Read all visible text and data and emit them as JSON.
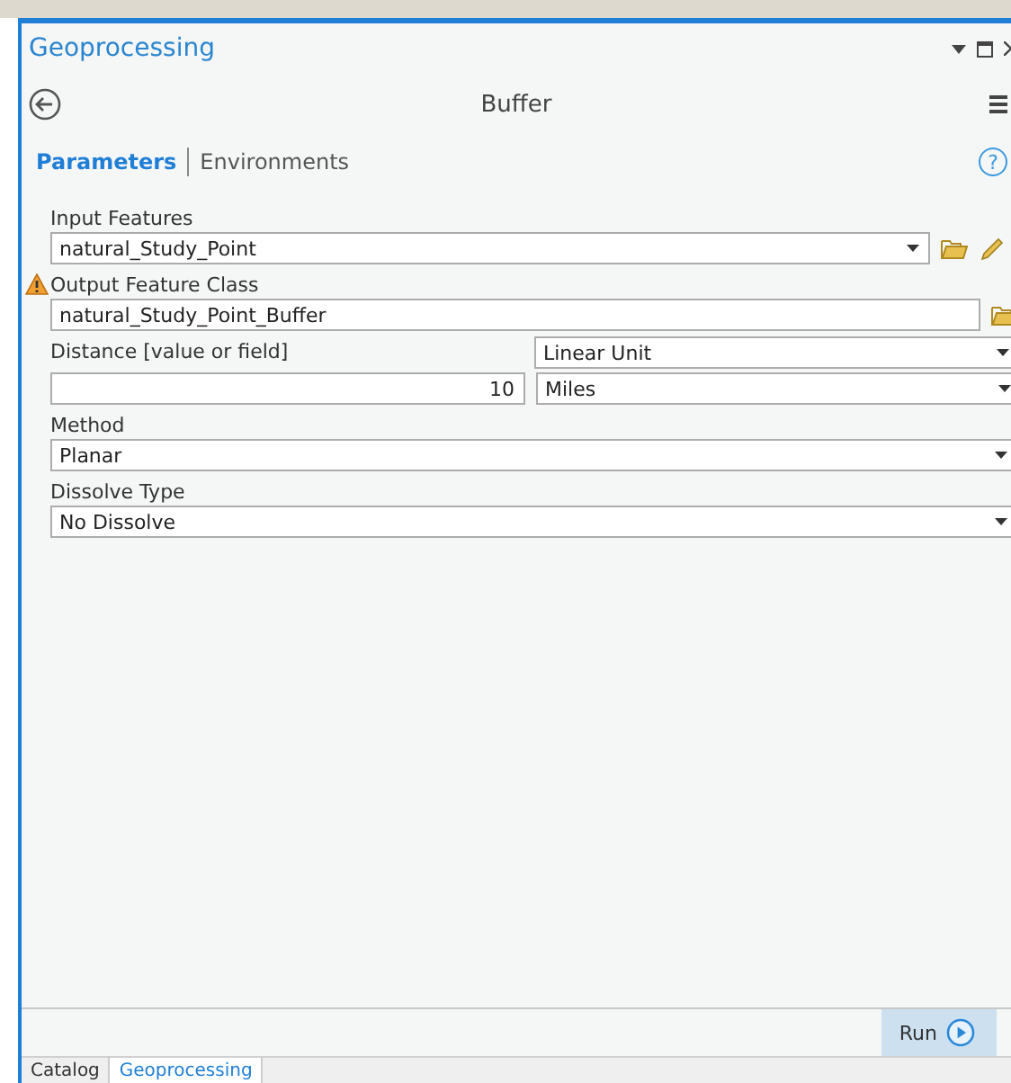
{
  "pane": {
    "title": "Geoprocessing"
  },
  "tool": {
    "title": "Buffer",
    "help": "?"
  },
  "tabs": [
    {
      "label": "Parameters",
      "selected": true
    },
    {
      "label": "Environments",
      "selected": false
    }
  ],
  "parameters": [
    {
      "kind": "dropdown",
      "label": "Input Features",
      "value": "natural_Study_Point",
      "browse": true,
      "edit": true
    },
    {
      "kind": "text",
      "label": "Output Feature Class",
      "value": "natural_Study_Point_Buffer",
      "warning": true,
      "browse": true
    },
    {
      "kind": "distance",
      "label": "Distance [value or field]",
      "value": "10",
      "type": "Linear Unit",
      "unit": "Miles"
    },
    {
      "kind": "dropdown",
      "label": "Method",
      "value": "Planar"
    },
    {
      "kind": "dropdown",
      "label": "Dissolve Type",
      "value": "No Dissolve"
    }
  ],
  "run_button": "Run",
  "bottom_tabs": [
    {
      "label": "Catalog",
      "selected": false
    },
    {
      "label": "Geoprocessing",
      "selected": true
    }
  ]
}
